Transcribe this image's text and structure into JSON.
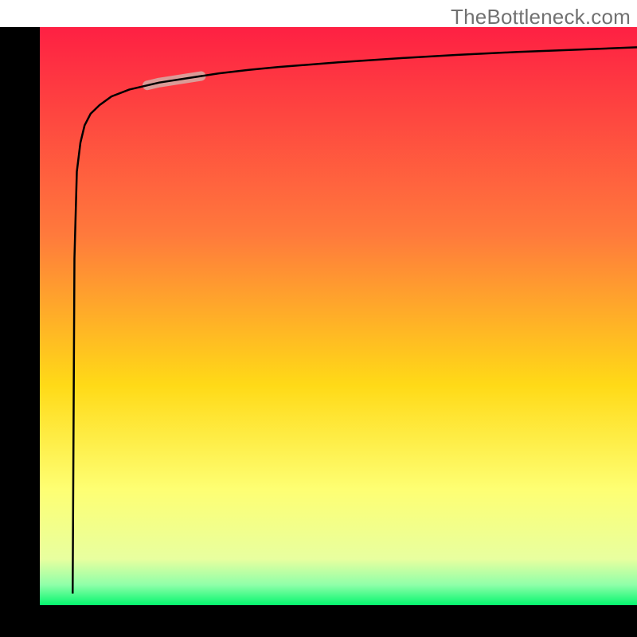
{
  "watermark": "TheBottleneck.com",
  "chart_data": {
    "type": "line",
    "title": "",
    "xlabel": "",
    "ylabel": "",
    "xlim": [
      0,
      100
    ],
    "ylim": [
      0,
      100
    ],
    "grid": false,
    "legend": false,
    "background_gradient": {
      "stops": [
        {
          "offset": 0.0,
          "color": "#fe2043"
        },
        {
          "offset": 0.36,
          "color": "#ff7a3c"
        },
        {
          "offset": 0.62,
          "color": "#ffda17"
        },
        {
          "offset": 0.8,
          "color": "#feff73"
        },
        {
          "offset": 0.92,
          "color": "#e8ff9f"
        },
        {
          "offset": 0.965,
          "color": "#8fffa9"
        },
        {
          "offset": 1.0,
          "color": "#05f66e"
        }
      ]
    },
    "series": [
      {
        "name": "curve",
        "x": [
          5.5,
          5.8,
          6.2,
          6.8,
          7.5,
          8.5,
          10,
          12,
          15,
          20,
          25,
          30,
          35,
          40,
          50,
          60,
          70,
          80,
          90,
          100
        ],
        "y": [
          2,
          60,
          75,
          80,
          83,
          85,
          86.5,
          88,
          89.2,
          90.4,
          91.2,
          92,
          92.6,
          93.1,
          93.9,
          94.6,
          95.2,
          95.7,
          96.1,
          96.5
        ]
      }
    ],
    "highlight_segment": {
      "series": "curve",
      "x_start": 18,
      "x_end": 27,
      "color": "#db9b97",
      "width": 12
    },
    "frame": {
      "color": "#000000",
      "left_width": 50,
      "bottom_height": 40,
      "top_inset": 34,
      "right_inset": 0
    }
  }
}
